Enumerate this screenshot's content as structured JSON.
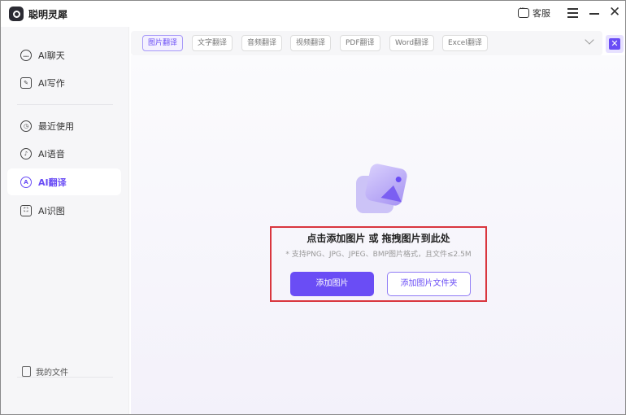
{
  "app": {
    "title": "聪明灵犀"
  },
  "titlebar": {
    "service_label": "客服"
  },
  "sidebar": {
    "items": [
      {
        "label": "AI聊天",
        "icon": "chat-icon"
      },
      {
        "label": "AI写作",
        "icon": "writing-icon"
      },
      {
        "label": "最近使用",
        "icon": "history-icon"
      },
      {
        "label": "AI语音",
        "icon": "voice-icon"
      },
      {
        "label": "AI翻译",
        "icon": "translate-icon",
        "active": true
      },
      {
        "label": "AI识图",
        "icon": "image-recognition-icon"
      }
    ],
    "footer_label": "我的文件"
  },
  "tabs": [
    "图片翻译",
    "文字翻译",
    "音频翻译",
    "视频翻译",
    "PDF翻译",
    "Word翻译",
    "Excel翻译"
  ],
  "active_tab": "图片翻译",
  "upload": {
    "title": "点击添加图片 或 拖拽图片到此处",
    "hint": "* 支持PNG、JPG、JPEG、BMP图片格式，且文件≤2.5M",
    "add_button": "添加图片",
    "add_folder_button": "添加图片文件夹"
  },
  "colors": {
    "accent": "#6a4df5",
    "highlight_border": "#d9363e"
  }
}
